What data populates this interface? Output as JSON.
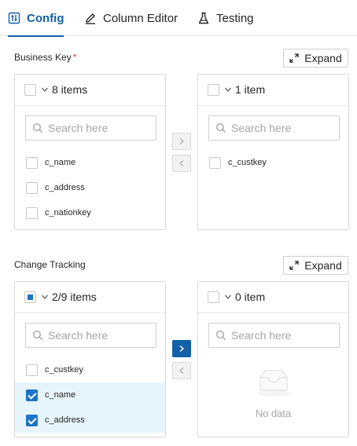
{
  "tabs": [
    {
      "label": "Config",
      "active": true,
      "icon": "sliders-icon"
    },
    {
      "label": "Column Editor",
      "active": false,
      "icon": "pencil-icon"
    },
    {
      "label": "Testing",
      "active": false,
      "icon": "flask-icon"
    }
  ],
  "business_key": {
    "label": "Business Key",
    "required_mark": "*",
    "expand_label": "Expand",
    "source": {
      "count_label": "8 items",
      "search_placeholder": "Search here",
      "items": [
        {
          "name": "c_name",
          "checked": false
        },
        {
          "name": "c_address",
          "checked": false
        },
        {
          "name": "c_nationkey",
          "checked": false
        }
      ]
    },
    "target": {
      "count_label": "1 item",
      "search_placeholder": "Search here",
      "items": [
        {
          "name": "c_custkey",
          "checked": false
        }
      ]
    }
  },
  "change_tracking": {
    "label": "Change Tracking",
    "expand_label": "Expand",
    "source": {
      "count_label": "2/9 items",
      "search_placeholder": "Search here",
      "items": [
        {
          "name": "c_custkey",
          "checked": false
        },
        {
          "name": "c_name",
          "checked": true
        },
        {
          "name": "c_address",
          "checked": true
        }
      ]
    },
    "target": {
      "count_label": "0 item",
      "search_placeholder": "Search here",
      "empty_text": "No data"
    }
  },
  "colors": {
    "accent": "#1260a8",
    "checkbox_blue": "#1e73c8",
    "selected_row": "#e6f4fc"
  }
}
